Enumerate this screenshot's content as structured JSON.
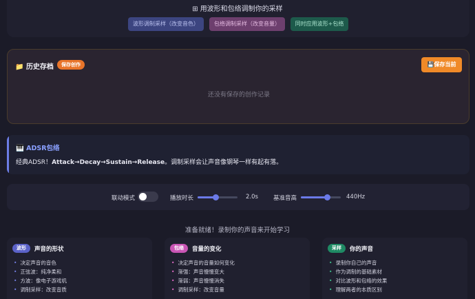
{
  "header": {
    "icon": "grid-icon",
    "title": "用波形和包络调制你的采样",
    "buttons": [
      {
        "label": "波形调制采样（改变音色）"
      },
      {
        "label": "包络调制采样（改变音量）"
      },
      {
        "label": "同时应用波形+包络"
      }
    ]
  },
  "history": {
    "icon": "folder-icon",
    "title": "历史存档",
    "badge": "保存创作",
    "save_icon": "floppy-icon",
    "save_label": "保存当前",
    "empty_text": "还没有保存的创作记录"
  },
  "adsr": {
    "icon": "piano-icon",
    "title": "ADSR包络",
    "text_prefix": "经典ADSR！",
    "text_bold": "Attack→Decay→Sustain→Release",
    "text_suffix": "。调制采样会让声音像钢琴一样有起有落。"
  },
  "controls": {
    "link_label": "联动模式",
    "link_on": false,
    "duration_label": "播放时长",
    "duration_value": "2.0s",
    "duration_fraction": 0.45,
    "pitch_label": "基准音高",
    "pitch_value": "440Hz",
    "pitch_fraction": 0.65
  },
  "status": "准备就绪！录制你的声音来开始学习",
  "cards": [
    {
      "tag": "波形",
      "title": "声音的形状",
      "items": [
        "决定声音的音色",
        "正弦波：纯净柔和",
        "方波：像电子游戏机",
        "调制采样：改变音质"
      ]
    },
    {
      "tag": "包络",
      "title": "音量的变化",
      "items": [
        "决定声音的音量如何变化",
        "渐强：声音慢慢变大",
        "渐弱：声音慢慢消失",
        "调制采样：改变音量"
      ]
    },
    {
      "tag": "采样",
      "title": "你的声音",
      "items": [
        "录制你自己的声音",
        "作为调制的基础素材",
        "对比波形和包络的效果",
        "理解两者的本质区别"
      ]
    }
  ],
  "colors": {
    "accent": "#6b7ae8",
    "orange": "#f08a28",
    "pink": "#c955b4",
    "green": "#1f8a64"
  }
}
